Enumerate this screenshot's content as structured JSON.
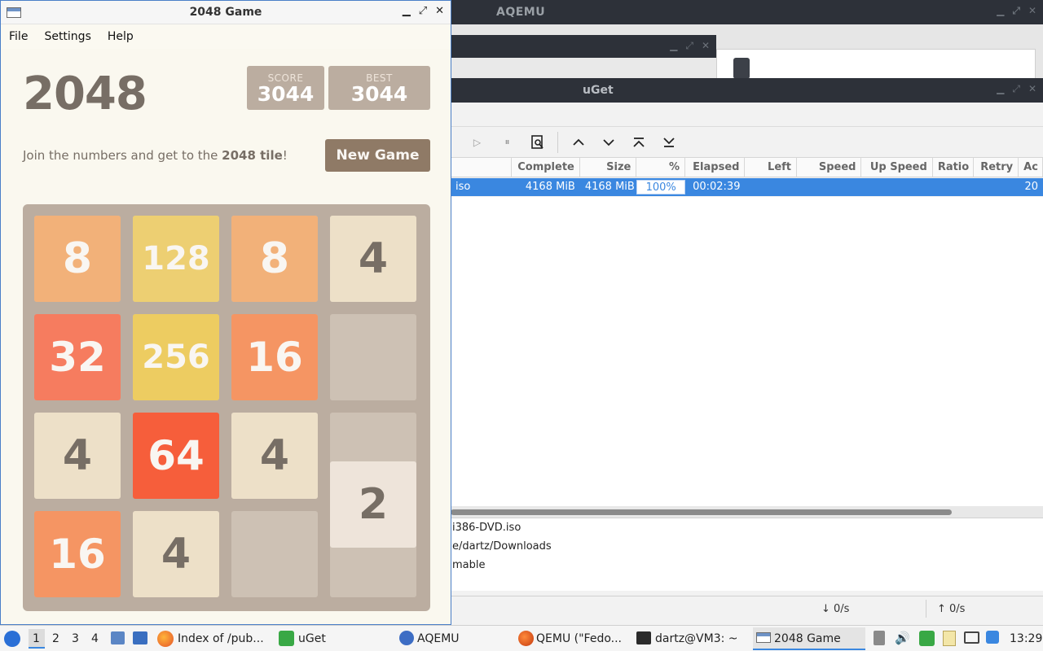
{
  "aqemu": {
    "title": "AQEMU"
  },
  "uget": {
    "title": "uGet",
    "columns": [
      "",
      "Complete",
      "Size",
      "%",
      "Elapsed",
      "Left",
      "Speed",
      "Up Speed",
      "Ratio",
      "Retry",
      "Ac"
    ],
    "row": {
      "name": "iso",
      "complete": "4168 MiB",
      "size": "4168 MiB",
      "percent": "100%",
      "elapsed": "00:02:39",
      "ac": "20"
    },
    "details": {
      "file": "i386-DVD.iso",
      "folder": "e/dartz/Downloads",
      "status": "mable"
    },
    "status": {
      "download": "↓ 0/s",
      "upload": "↑ 0/s"
    }
  },
  "game": {
    "window_title": "2048 Game",
    "menu": [
      "File",
      "Settings",
      "Help"
    ],
    "heading": "2048",
    "score_label": "SCORE",
    "score": "3044",
    "best_label": "BEST",
    "best": "3044",
    "intro_prefix": "Join the numbers and get to the ",
    "intro_bold": "2048 tile",
    "intro_suffix": "!",
    "new_game": "New Game",
    "board": [
      [
        "8",
        "128",
        "8",
        "4"
      ],
      [
        "32",
        "256",
        "16",
        ""
      ],
      [
        "4",
        "64",
        "4",
        ""
      ],
      [
        "16",
        "4",
        "",
        ""
      ]
    ],
    "floating_tile": "2"
  },
  "taskbar": {
    "workspaces": [
      "1",
      "2",
      "3",
      "4"
    ],
    "tasks": [
      "Index of /pub...",
      "uGet",
      "AQEMU",
      "QEMU (\"Fedo...",
      "dartz@VM3: ~",
      "2048 Game"
    ],
    "clock": "13:29"
  }
}
